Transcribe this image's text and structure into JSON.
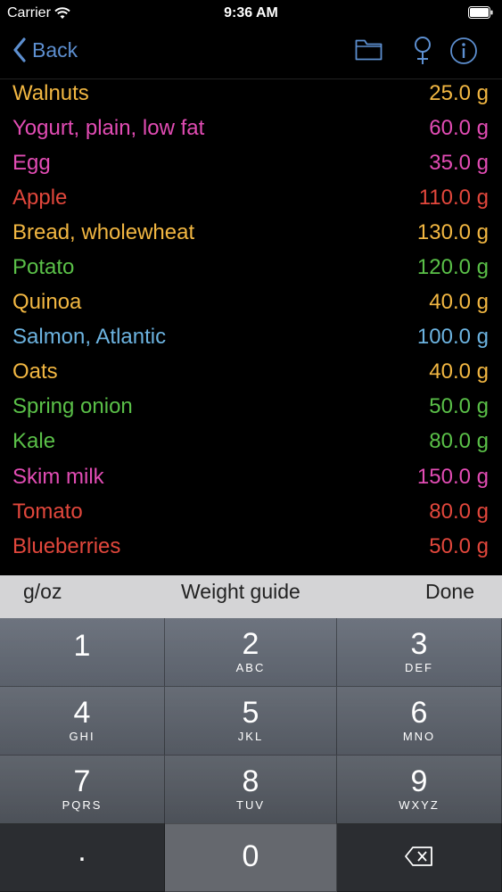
{
  "status_bar": {
    "carrier": "Carrier",
    "time": "9:36 AM"
  },
  "nav": {
    "back_label": "Back",
    "icons": [
      "folder-icon",
      "female-symbol-icon",
      "info-icon"
    ]
  },
  "foods": [
    {
      "name": "Walnuts",
      "amount": "25.0 g",
      "color": "#f2b742"
    },
    {
      "name": "Yogurt, plain, low fat",
      "amount": "60.0 g",
      "color": "#e24cb4"
    },
    {
      "name": "Egg",
      "amount": "35.0 g",
      "color": "#e24cb4"
    },
    {
      "name": "Apple",
      "amount": "110.0 g",
      "color": "#e2473c"
    },
    {
      "name": "Bread, wholewheat",
      "amount": "130.0 g",
      "color": "#f2b742"
    },
    {
      "name": "Potato",
      "amount": "120.0 g",
      "color": "#5ac048"
    },
    {
      "name": "Quinoa",
      "amount": "40.0 g",
      "color": "#f2b742"
    },
    {
      "name": "Salmon, Atlantic",
      "amount": "100.0 g",
      "color": "#6cb3e0"
    },
    {
      "name": "Oats",
      "amount": "40.0 g",
      "color": "#f2b742"
    },
    {
      "name": "Spring onion",
      "amount": "50.0 g",
      "color": "#5ac048"
    },
    {
      "name": "Kale",
      "amount": "80.0 g",
      "color": "#5ac048"
    },
    {
      "name": "Skim milk",
      "amount": "150.0 g",
      "color": "#e24cb4"
    },
    {
      "name": "Tomato",
      "amount": "80.0 g",
      "color": "#e2473c"
    },
    {
      "name": "Blueberries",
      "amount": "50.0 g",
      "color": "#e2473c"
    }
  ],
  "accessory": {
    "unit_toggle": "g/oz",
    "weight_guide": "Weight guide",
    "done": "Done"
  },
  "keypad": {
    "keys": [
      {
        "digit": "1",
        "letters": ""
      },
      {
        "digit": "2",
        "letters": "ABC"
      },
      {
        "digit": "3",
        "letters": "DEF"
      },
      {
        "digit": "4",
        "letters": "GHI"
      },
      {
        "digit": "5",
        "letters": "JKL"
      },
      {
        "digit": "6",
        "letters": "MNO"
      },
      {
        "digit": "7",
        "letters": "PQRS"
      },
      {
        "digit": "8",
        "letters": "TUV"
      },
      {
        "digit": "9",
        "letters": "WXYZ"
      }
    ],
    "decimal": ".",
    "zero": "0",
    "delete_icon": "backspace-icon"
  }
}
